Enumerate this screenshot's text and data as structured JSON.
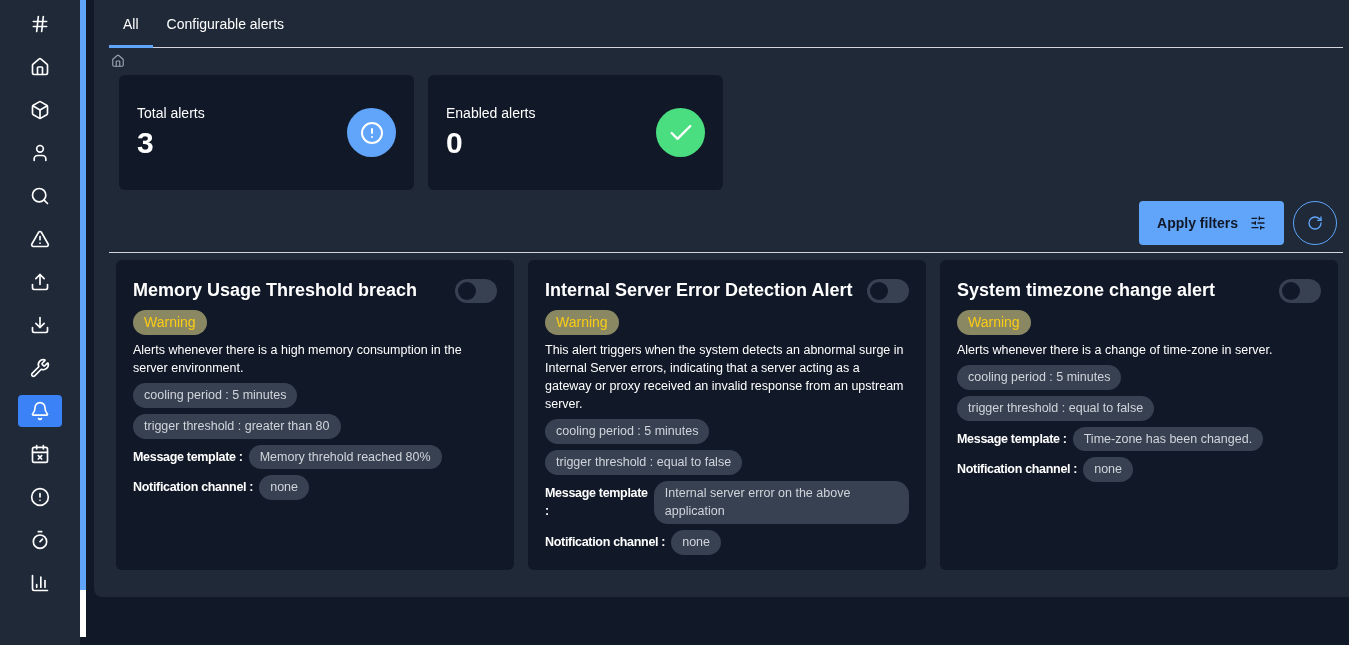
{
  "sidebar": {
    "items": [
      {
        "selected": false
      },
      {
        "selected": false
      },
      {
        "selected": false
      },
      {
        "selected": false
      },
      {
        "selected": false
      },
      {
        "selected": false
      },
      {
        "selected": false
      },
      {
        "selected": false
      },
      {
        "selected": false
      },
      {
        "selected": true
      },
      {
        "selected": false
      },
      {
        "selected": false
      },
      {
        "selected": false
      },
      {
        "selected": false
      }
    ]
  },
  "tabs": [
    {
      "label": "All",
      "selected": true
    },
    {
      "label": "Configurable alerts",
      "selected": false
    }
  ],
  "stats": [
    {
      "label": "Total alerts",
      "value": "3",
      "kind": "info",
      "color": "#60a5fa"
    },
    {
      "label": "Enabled alerts",
      "value": "0",
      "kind": "check",
      "color": "#4ade80"
    }
  ],
  "filters": {
    "apply_label": "Apply filters"
  },
  "alerts": [
    {
      "title": "Memory Usage Threshold breach",
      "enabled": false,
      "severity": "Warning",
      "description": "Alerts whenever there is a high memory consumption in the server environment.",
      "chips": [
        "cooling period : 5 minutes",
        "trigger threshold : greater than 80"
      ],
      "template_label": "Message template :",
      "template": "Memory threhold reached 80%",
      "channel_label": "Notification channel :",
      "channel": "none"
    },
    {
      "title": "Internal Server Error Detection Alert",
      "enabled": false,
      "severity": "Warning",
      "description": "This alert triggers when the system detects an abnormal surge in Internal Server errors, indicating that a server acting as a gateway or proxy received an invalid response from an upstream server.",
      "chips": [
        "cooling period : 5 minutes",
        "trigger threshold : equal to false"
      ],
      "template_label": "Message template :",
      "template": "Internal server error on the above application",
      "channel_label": "Notification channel :",
      "channel": "none"
    },
    {
      "title": "System timezone change alert",
      "enabled": false,
      "severity": "Warning",
      "description": "Alerts whenever there is a change of time-zone in server.",
      "chips": [
        "cooling period : 5 minutes",
        "trigger threshold : equal to false"
      ],
      "template_label": "Message template :",
      "template": "Time-zone has been changed.",
      "channel_label": "Notification channel :",
      "channel": "none"
    }
  ]
}
